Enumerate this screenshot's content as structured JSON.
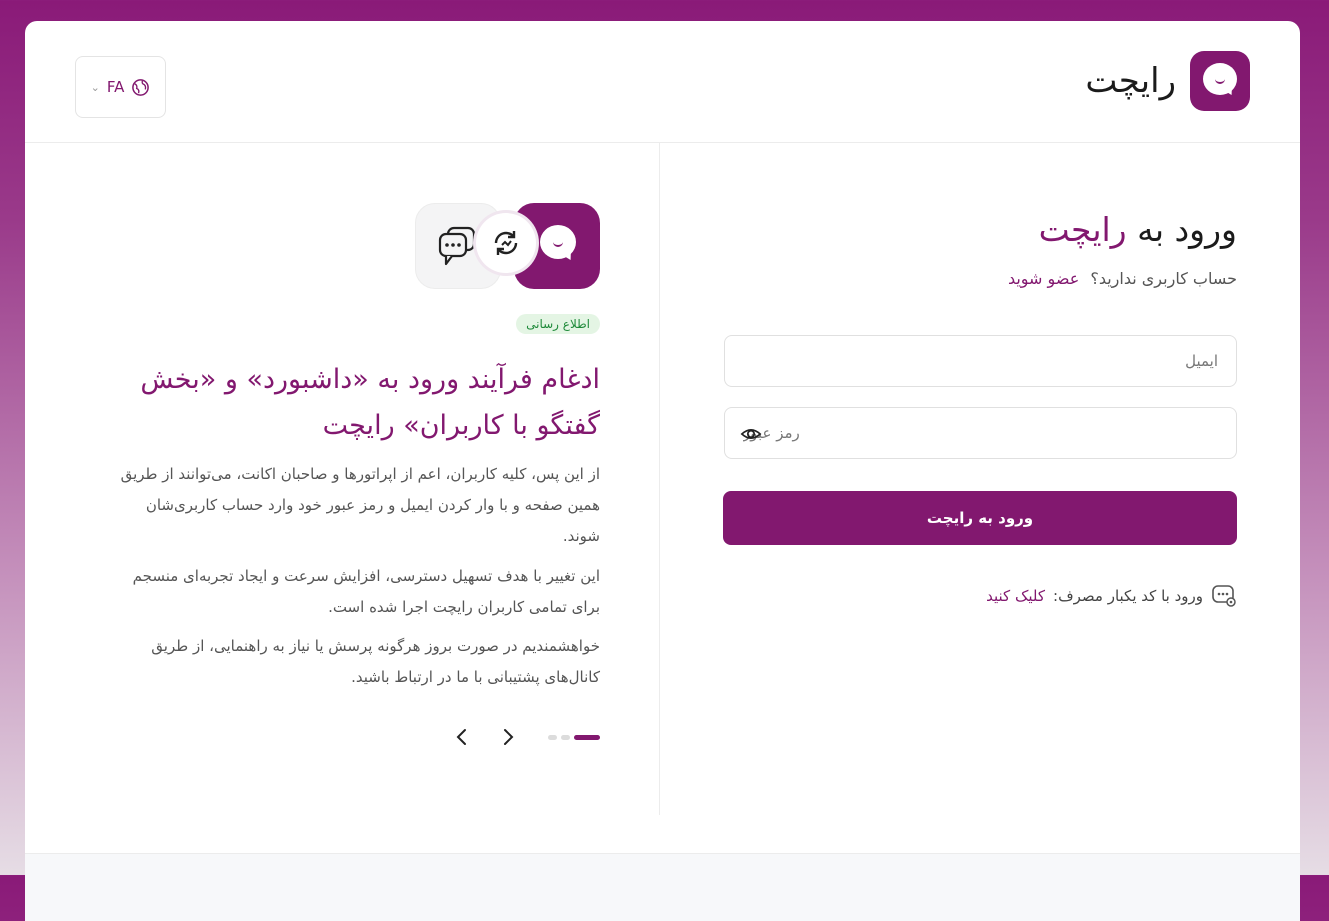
{
  "brand": {
    "name": "رایچت",
    "color": "#82186f"
  },
  "language": {
    "code": "FA",
    "icon": "globe-icon"
  },
  "login": {
    "title_prefix": "ورود به",
    "title_accent": "رایچت",
    "no_account": "حساب کاربری ندارید؟",
    "signup_link": "عضو شوید",
    "email_placeholder": "ایمیل",
    "password_placeholder": "رمز عبور",
    "submit_label": "ورود به رایچت",
    "otp_text": "ورود با کد یکبار مصرف:",
    "otp_link": "کلیک کنید"
  },
  "news": {
    "badge": "اطلاع رسانی",
    "title": "ادغام فرآیند ورود به «داشبورد» و «بخش گفتگو با کاربران» رایچت",
    "paragraphs": [
      "از این پس، کلیه کاربران، اعم از اپراتورها و صاحبان اکانت، می‌توانند از طریق همین صفحه و با وار کردن ایمیل و رمز عبور خود وارد حساب کاربری‌شان شوند.",
      "این تغییر با هدف تسهیل دسترسی، افزایش سرعت و ایجاد تجربه‌ای منسجم برای تمامی کاربران رایچت اجرا شده است.",
      "خواهشمندیم در صورت بروز هرگونه پرسش یا نیاز به راهنمایی، از طریق کانال‌های پشتیبانی با ما در ارتباط باشید."
    ],
    "slides_total": 3,
    "slide_active": 1
  }
}
